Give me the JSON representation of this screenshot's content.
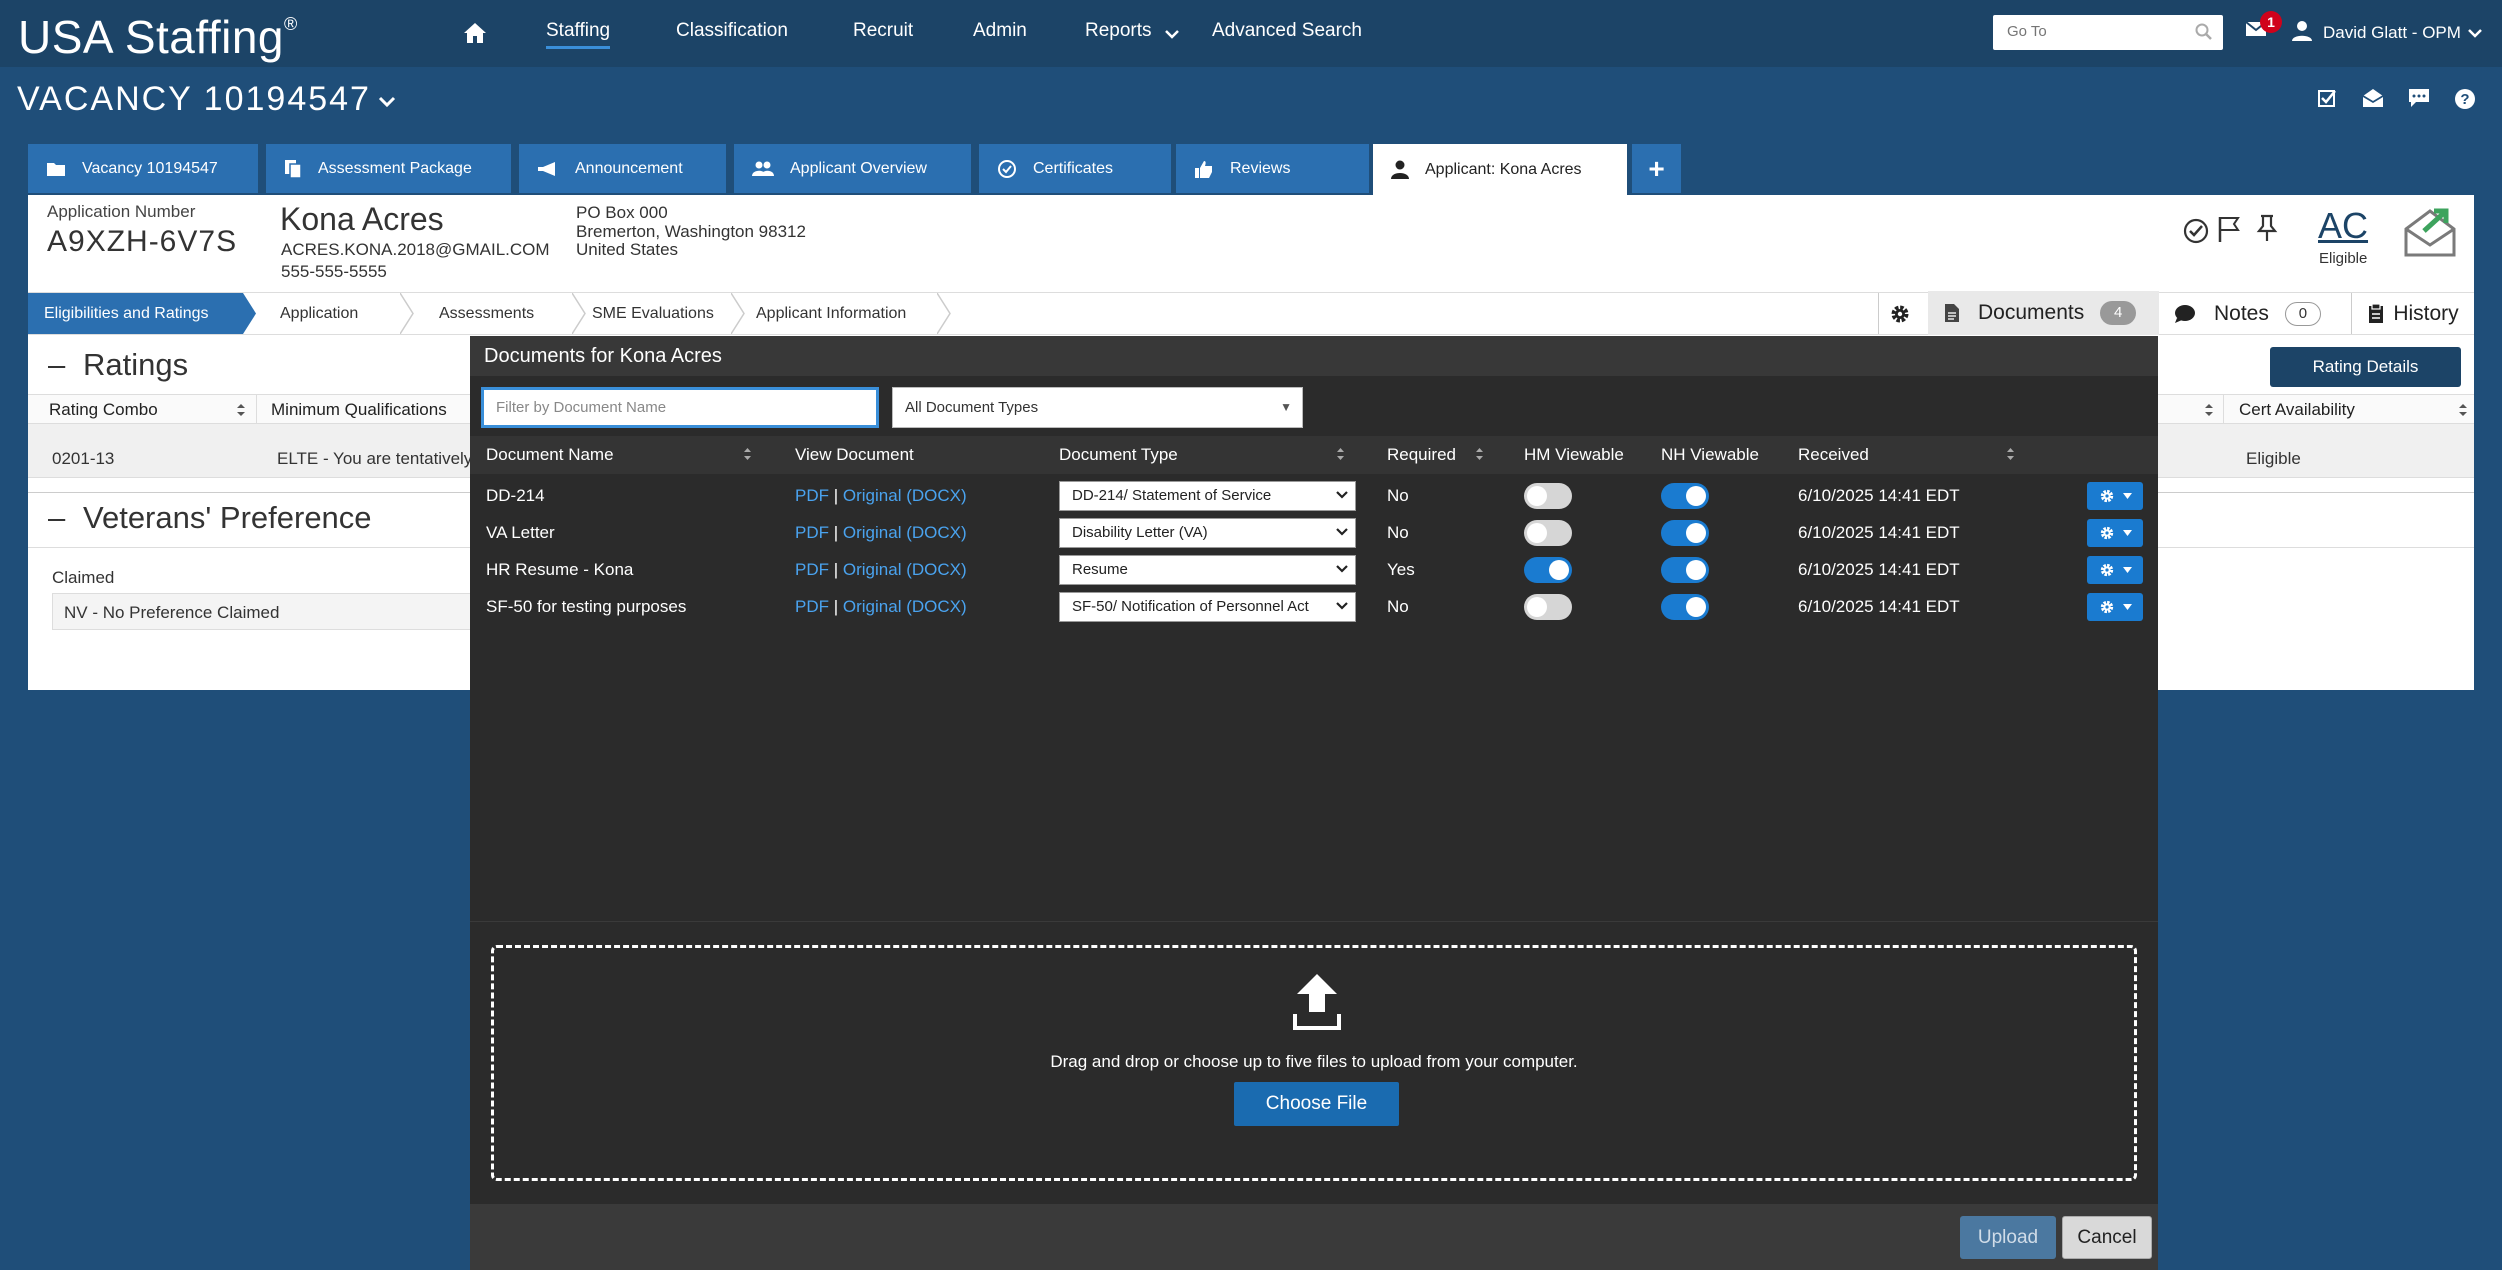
{
  "brand": {
    "name": "USA Staffing",
    "mark": "®"
  },
  "nav": {
    "items": [
      "Staffing",
      "Classification",
      "Recruit",
      "Admin",
      "Reports",
      "Advanced Search"
    ],
    "goto_placeholder": "Go To",
    "mail_count": "1",
    "user": "David Glatt - OPM"
  },
  "vacancy": {
    "title": "VACANCY 10194547"
  },
  "tabs": [
    "Vacancy 10194547",
    "Assessment Package",
    "Announcement",
    "Applicant Overview",
    "Certificates",
    "Reviews",
    "Applicant: Kona Acres",
    "+"
  ],
  "applicant": {
    "number_label": "Application Number",
    "number": "A9XZH-6V7S",
    "name": "Kona Acres",
    "email": "ACRES.KONA.2018@GMAIL.COM",
    "phone": "555-555-5555",
    "address1": "PO Box 000",
    "address2": "Bremerton, Washington 98312",
    "address3": "United States",
    "initials": "AC",
    "status": "Eligible"
  },
  "steps": [
    "Eligibilities and Ratings",
    "Application",
    "Assessments",
    "SME Evaluations",
    "Applicant Information"
  ],
  "side_tabs": {
    "documents": "Documents",
    "documents_count": "4",
    "notes": "Notes",
    "notes_count": "0",
    "history": "History"
  },
  "ratings": {
    "title": "Ratings",
    "collapse": "–",
    "headers": [
      "Rating Combo",
      "Minimum Qualifications",
      "Cert Availability"
    ],
    "row": {
      "combo": "0201-13",
      "mq": "ELTE - You are tentatively",
      "cert": "Eligible"
    },
    "details_button": "Rating Details"
  },
  "vets": {
    "title": "Veterans' Preference",
    "collapse": "–",
    "claimed_label": "Claimed",
    "claimed_value": "NV - No Preference Claimed"
  },
  "documents": {
    "title": "Documents for Kona Acres",
    "filter_placeholder": "Filter by Document Name",
    "type_filter": "All Document Types",
    "headers": [
      "Document Name",
      "View Document",
      "Document Type",
      "Required",
      "HM Viewable",
      "NH Viewable",
      "Received"
    ],
    "pdf_label": "PDF",
    "separator": "|",
    "original_label": "Original (DOCX)",
    "rows": [
      {
        "name": "DD-214",
        "type": "DD-214/ Statement of Service",
        "required": "No",
        "hm": false,
        "nh": true,
        "received": "6/10/2025 14:41 EDT"
      },
      {
        "name": "VA Letter",
        "type": "Disability Letter (VA)",
        "required": "No",
        "hm": false,
        "nh": true,
        "received": "6/10/2025 14:41 EDT"
      },
      {
        "name": "HR Resume - Kona",
        "type": "Resume",
        "required": "Yes",
        "hm": true,
        "nh": true,
        "received": "6/10/2025 14:41 EDT"
      },
      {
        "name": "SF-50 for testing purposes",
        "type": "SF-50/ Notification of Personnel Act",
        "required": "No",
        "hm": false,
        "nh": true,
        "received": "6/10/2025 14:41 EDT"
      }
    ],
    "drop_text": "Drag and drop or choose up to five files to upload from your computer.",
    "choose_file": "Choose File",
    "upload": "Upload",
    "cancel": "Cancel"
  },
  "colors": {
    "nav_bg": "#1c4467",
    "tab_bg": "#2b6fb0",
    "page_bg": "#1f4e79",
    "modal_bg": "#2b2b2b",
    "toggle_on": "#1a7bd0",
    "link": "#4aa3ef"
  }
}
